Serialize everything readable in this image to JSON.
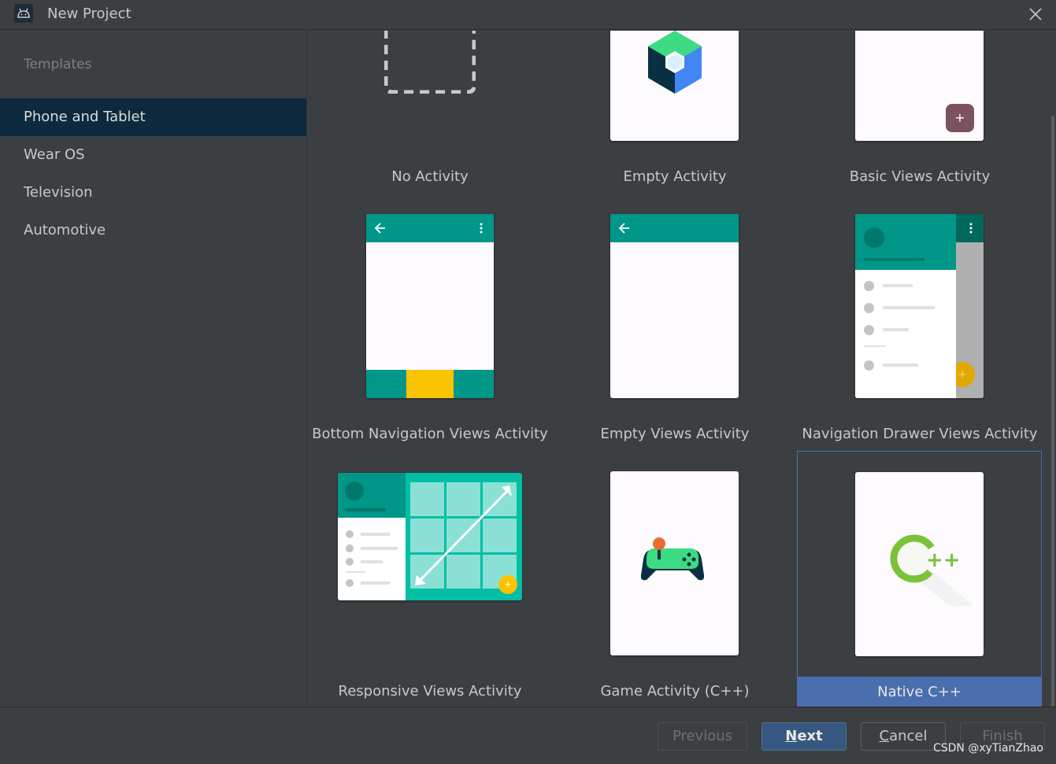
{
  "window": {
    "title": "New Project"
  },
  "sidebar": {
    "heading": "Templates",
    "items": [
      {
        "label": "Phone and Tablet",
        "selected": true
      },
      {
        "label": "Wear OS",
        "selected": false
      },
      {
        "label": "Television",
        "selected": false
      },
      {
        "label": "Automotive",
        "selected": false
      }
    ]
  },
  "templates": [
    {
      "label": "No Activity"
    },
    {
      "label": "Empty Activity"
    },
    {
      "label": "Basic Views Activity"
    },
    {
      "label": "Bottom Navigation Views Activity"
    },
    {
      "label": "Empty Views Activity"
    },
    {
      "label": "Navigation Drawer Views Activity"
    },
    {
      "label": "Responsive Views Activity"
    },
    {
      "label": "Game Activity (C++)"
    },
    {
      "label": "Native C++",
      "selected": true
    }
  ],
  "footer": {
    "previous": "Previous",
    "next_mnemonic": "N",
    "next_rest": "ext",
    "cancel_mnemonic": "C",
    "cancel_rest": "ancel",
    "finish": "Finish"
  },
  "watermark": "CSDN @xyTianZhao",
  "colors": {
    "teal": "#009688",
    "selection": "#4b6eaf",
    "sidebar_selected": "#0d293e",
    "primary_button": "#365880",
    "accent_yellow": "#fbbc05"
  }
}
